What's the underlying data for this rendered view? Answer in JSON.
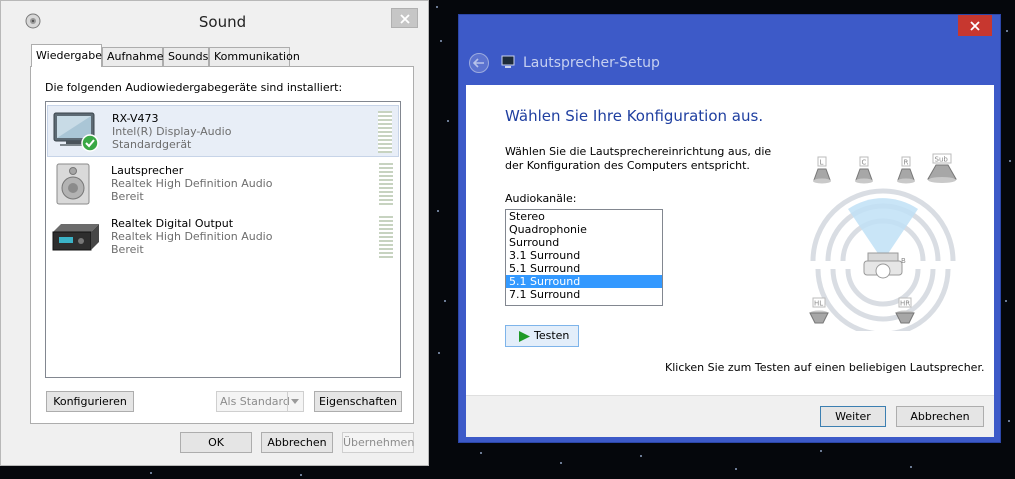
{
  "sound_dialog": {
    "title": "Sound",
    "tabs": [
      {
        "label": "Wiedergabe",
        "active": true
      },
      {
        "label": "Aufnahme",
        "active": false
      },
      {
        "label": "Sounds",
        "active": false
      },
      {
        "label": "Kommunikation",
        "active": false
      }
    ],
    "heading": "Die folgenden Audiowiedergabegeräte sind installiert:",
    "devices": [
      {
        "name": "RX-V473",
        "driver": "Intel(R) Display-Audio",
        "status": "Standardgerät",
        "icon": "tv-monitor-default-icon",
        "selected": true
      },
      {
        "name": "Lautsprecher",
        "driver": "Realtek High Definition Audio",
        "status": "Bereit",
        "icon": "speaker-icon",
        "selected": false
      },
      {
        "name": "Realtek Digital Output",
        "driver": "Realtek High Definition Audio",
        "status": "Bereit",
        "icon": "digital-output-device-icon",
        "selected": false
      }
    ],
    "buttons": {
      "configure": "Konfigurieren",
      "set_default": "Als Standard",
      "properties": "Eigenschaften",
      "ok": "OK",
      "cancel": "Abbrechen",
      "apply": "Übernehmen"
    }
  },
  "speaker_setup": {
    "title": "Lautsprecher-Setup",
    "heading": "Wählen Sie Ihre Konfiguration aus.",
    "description": "Wählen Sie die Lautsprechereinrichtung aus, die der Konfiguration des Computers entspricht.",
    "channels_label": "Audiokanäle:",
    "channels": [
      "Stereo",
      "Quadrophonie",
      "Surround",
      "3.1 Surround",
      "5.1 Surround",
      "5.1 Surround",
      "7.1 Surround"
    ],
    "selected_channel_index": 5,
    "test_button": "Testen",
    "hint": "Klicken Sie zum Testen auf einen beliebigen Lautsprecher.",
    "speaker_labels": {
      "left": "L",
      "center": "C",
      "right": "R",
      "sub": "Sub",
      "rear_left": "HL",
      "rear_right": "HR"
    },
    "buttons": {
      "next": "Weiter",
      "cancel": "Abbrechen"
    }
  }
}
